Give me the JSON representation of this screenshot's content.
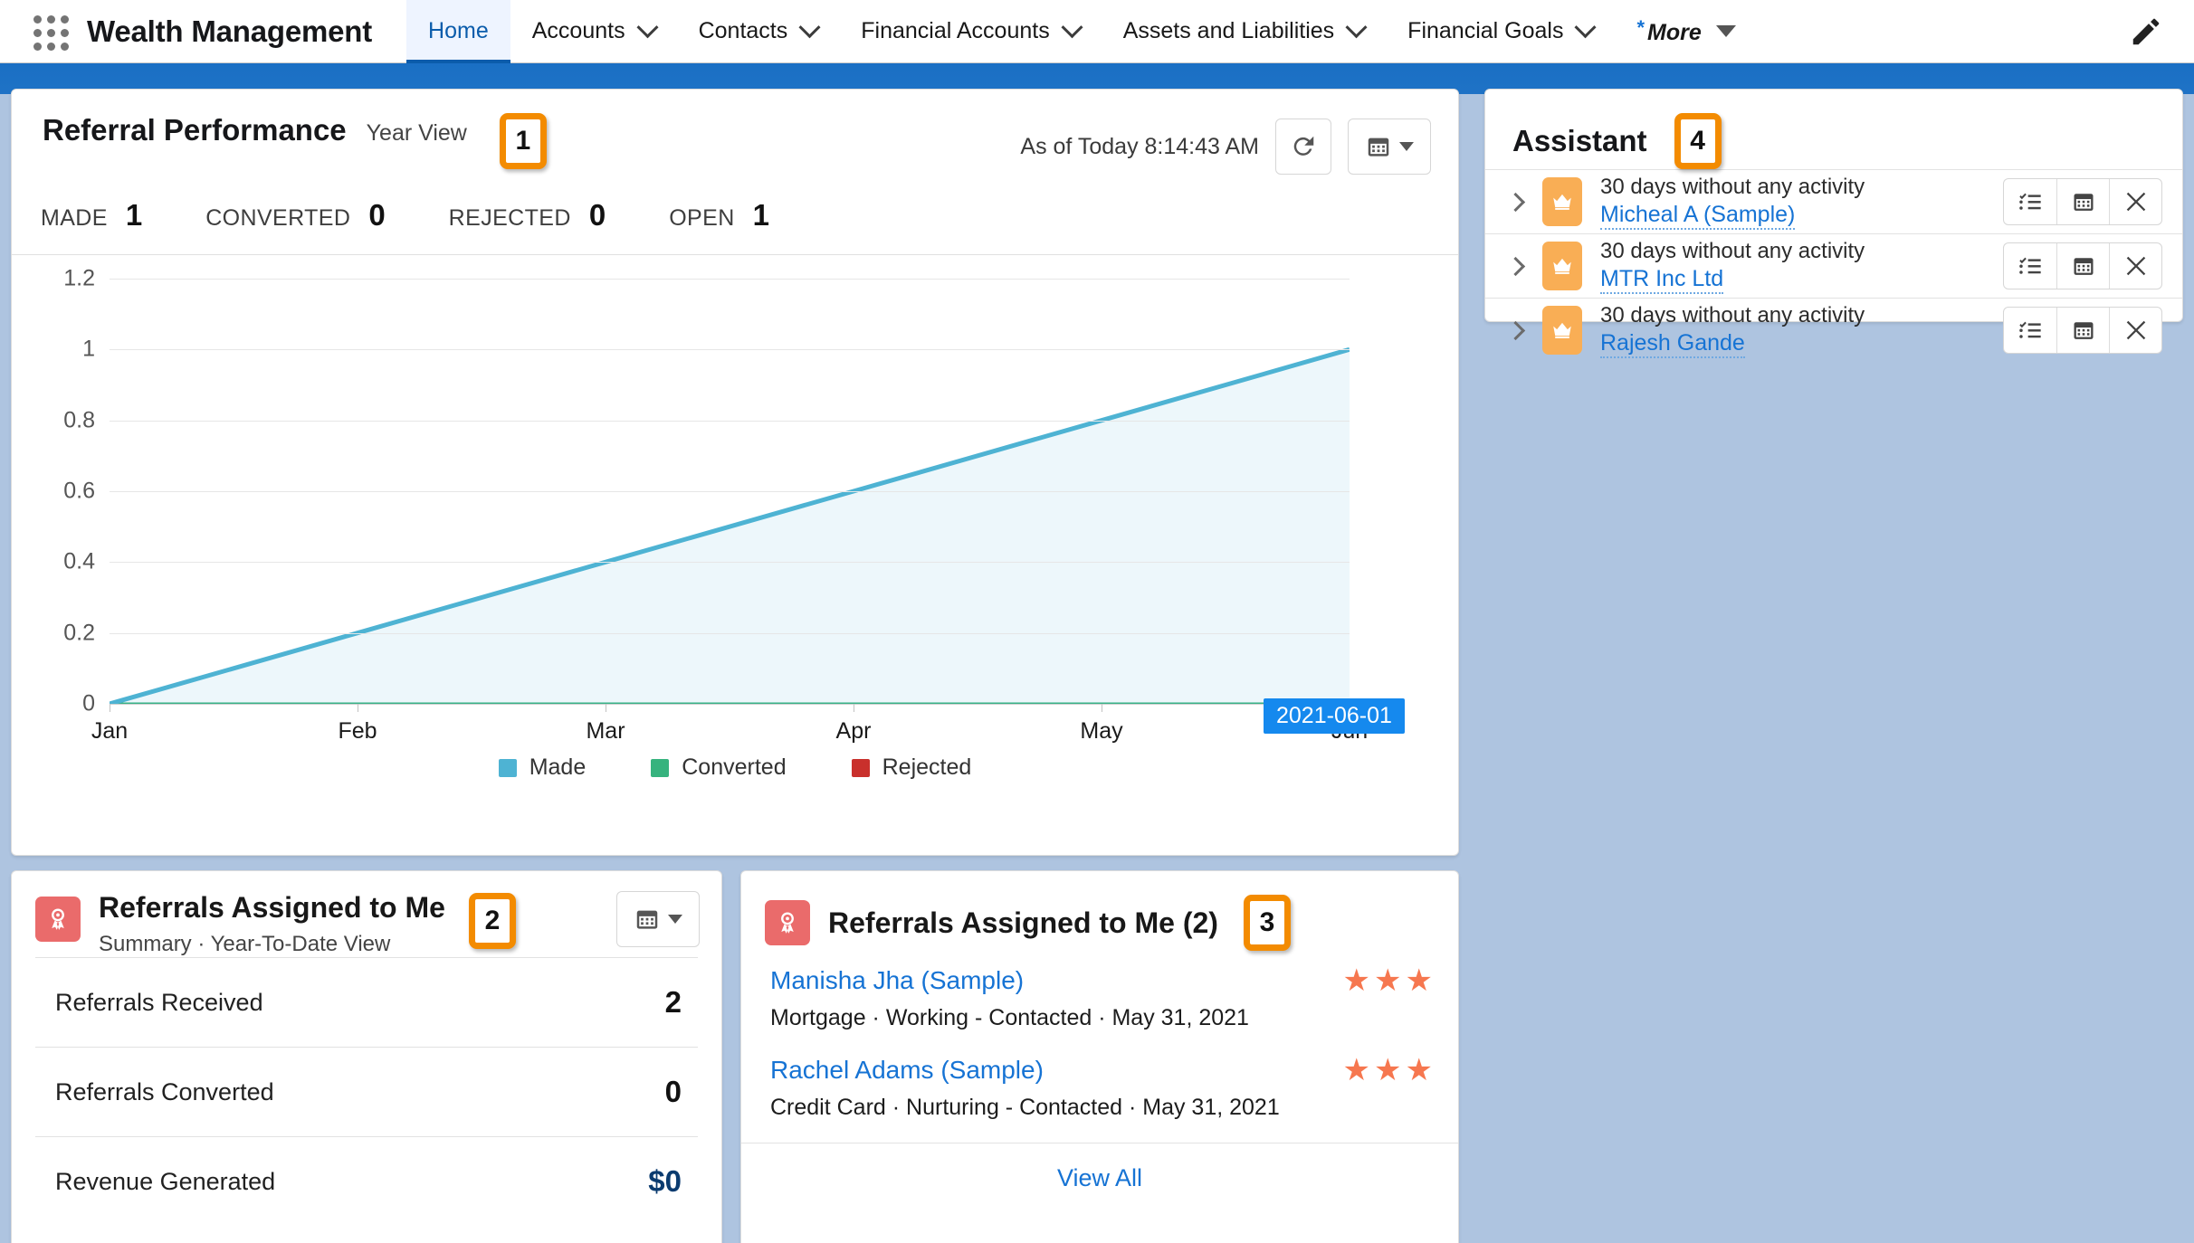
{
  "topbar": {
    "waffle_label": "app-launcher",
    "app_title": "Wealth Management",
    "tabs": [
      {
        "label": "Home",
        "has_chevron": false,
        "active": true
      },
      {
        "label": "Accounts",
        "has_chevron": true,
        "active": false
      },
      {
        "label": "Contacts",
        "has_chevron": true,
        "active": false
      },
      {
        "label": "Financial Accounts",
        "has_chevron": true,
        "active": false
      },
      {
        "label": "Assets and Liabilities",
        "has_chevron": true,
        "active": false
      },
      {
        "label": "Financial Goals",
        "has_chevron": true,
        "active": false
      }
    ],
    "more": {
      "star": "*",
      "label": "More"
    },
    "edit_icon": "pencil-icon"
  },
  "referral_performance": {
    "title": "Referral Performance",
    "subtitle": "Year View",
    "badge": "1",
    "as_of": "As of Today 8:14:43 AM",
    "refresh_icon": "refresh-icon",
    "calendar_icon": "calendar-icon",
    "metrics": [
      {
        "label": "MADE",
        "value": "1"
      },
      {
        "label": "CONVERTED",
        "value": "0"
      },
      {
        "label": "REJECTED",
        "value": "0"
      },
      {
        "label": "OPEN",
        "value": "1"
      }
    ],
    "tooltip": "2021-06-01"
  },
  "chart_data": {
    "type": "area",
    "title": "Referral Performance",
    "xlabel": "",
    "ylabel": "",
    "categories": [
      "Jan",
      "Feb",
      "Mar",
      "Apr",
      "May",
      "Jun"
    ],
    "yticks": [
      "0",
      "0.2",
      "0.4",
      "0.6",
      "0.8",
      "1",
      "1.2"
    ],
    "ylim": [
      0,
      1.2
    ],
    "grid": true,
    "legend_position": "bottom",
    "annotation": "2021-06-01",
    "series": [
      {
        "name": "Made",
        "color": "#4eb3d3",
        "values": [
          0,
          0.2,
          0.4,
          0.6,
          0.8,
          1
        ]
      },
      {
        "name": "Converted",
        "color": "#36b37e",
        "values": [
          0,
          0,
          0,
          0,
          0,
          0
        ]
      },
      {
        "name": "Rejected",
        "color": "#c9302c",
        "values": [
          0,
          0,
          0,
          0,
          0,
          0
        ]
      }
    ]
  },
  "assistant": {
    "title": "Assistant",
    "badge": "4",
    "rows": [
      {
        "text": "30 days without any activity",
        "link": "Micheal A (Sample)"
      },
      {
        "text": "30 days without any activity",
        "link": "MTR Inc Ltd"
      },
      {
        "text": "30 days without any activity",
        "link": "Rajesh Gande"
      }
    ],
    "row_actions": [
      "task-list-icon",
      "calendar-icon",
      "close-icon"
    ]
  },
  "summary_card": {
    "icon": "referral-badge-icon",
    "title": "Referrals Assigned to Me",
    "subtitle": "Summary  ·  Year-To-Date View",
    "badge": "2",
    "calendar_icon": "calendar-icon",
    "rows": [
      {
        "label": "Referrals Received",
        "value": "2",
        "money": false
      },
      {
        "label": "Referrals Converted",
        "value": "0",
        "money": false
      },
      {
        "label": "Revenue Generated",
        "value": "$0",
        "money": true
      }
    ]
  },
  "list_card": {
    "icon": "referral-badge-icon",
    "title": "Referrals Assigned to Me (2)",
    "badge": "3",
    "items": [
      {
        "name": "Manisha Jha (Sample)",
        "meta": "Mortgage  ·  Working - Contacted  ·  May 31, 2021",
        "stars": 3
      },
      {
        "name": "Rachel Adams (Sample)",
        "meta": "Credit Card  ·  Nurturing - Contacted  ·  May 31, 2021",
        "stars": 3
      }
    ],
    "view_all": "View All"
  },
  "colors": {
    "brand_blue": "#1a6fc4",
    "link_blue": "#1673d4",
    "badge_orange": "#f38b00",
    "made": "#4eb3d3",
    "converted": "#36b37e",
    "rejected": "#c9302c",
    "star": "#f6774f",
    "money": "#0b3b6f"
  }
}
